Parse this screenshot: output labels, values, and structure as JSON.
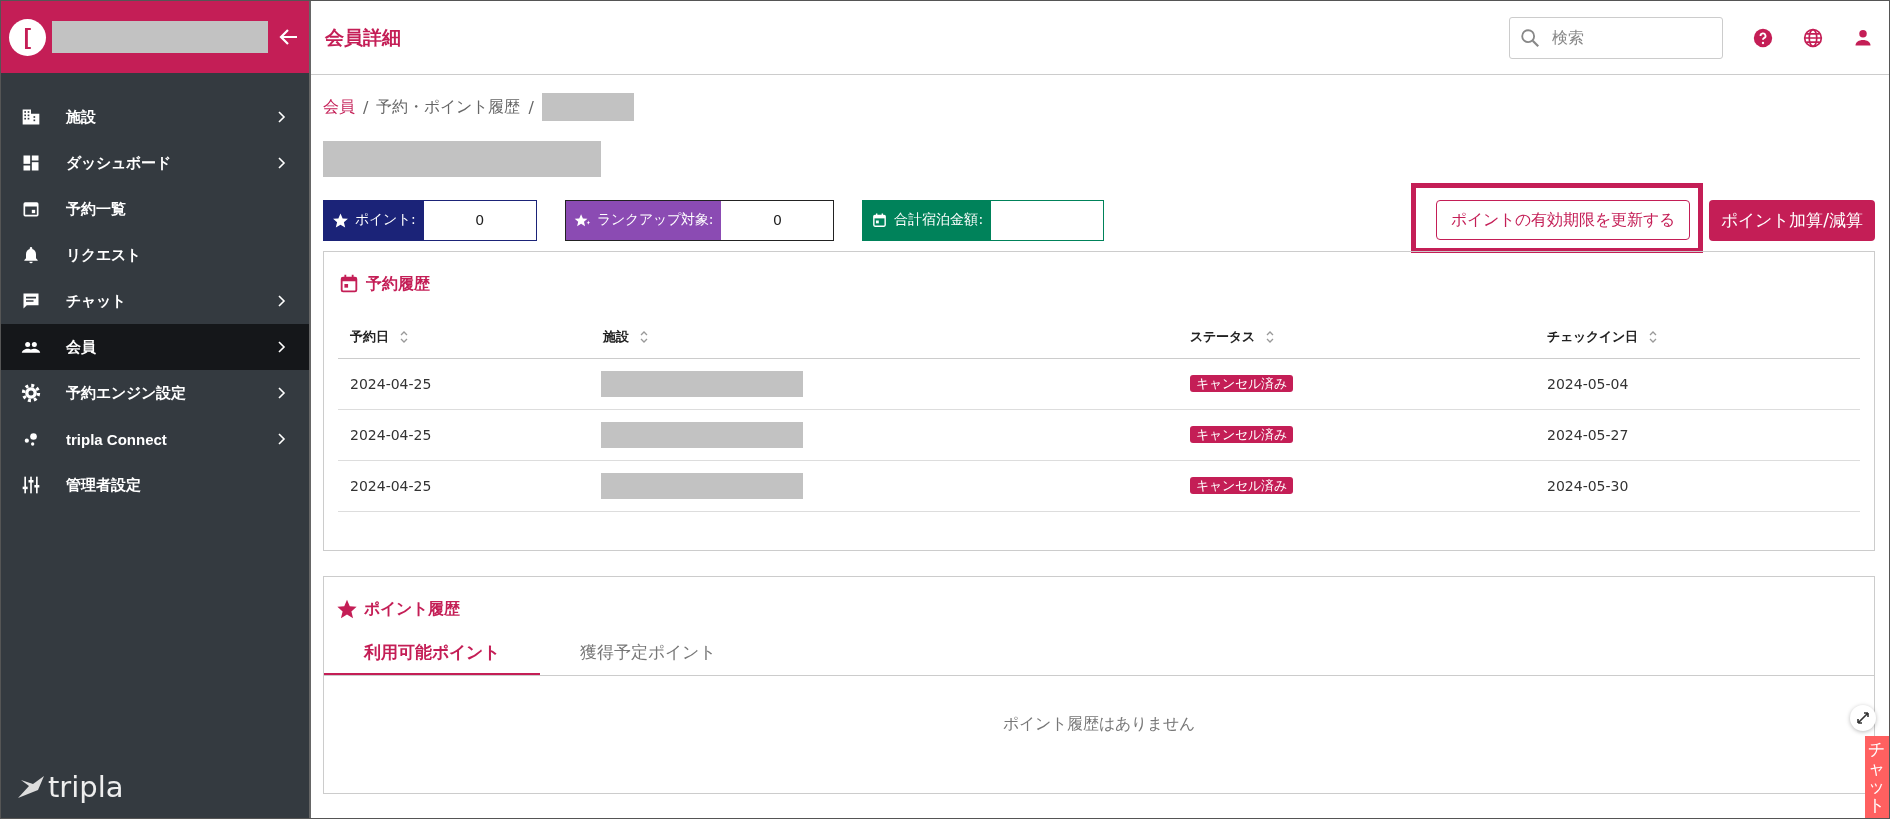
{
  "sidebar": {
    "logo_mark": "[",
    "items": [
      {
        "label": "施設",
        "kind": "building",
        "has_submenu": true,
        "selected": false
      },
      {
        "label": "ダッシュボード",
        "kind": "dashboard",
        "has_submenu": true,
        "selected": false
      },
      {
        "label": "予約一覧",
        "kind": "calendar",
        "has_submenu": false,
        "selected": false
      },
      {
        "label": "リクエスト",
        "kind": "bell",
        "has_submenu": false,
        "selected": false
      },
      {
        "label": "チャット",
        "kind": "chat",
        "has_submenu": true,
        "selected": false
      },
      {
        "label": "会員",
        "kind": "people",
        "has_submenu": true,
        "selected": true
      },
      {
        "label": "予約エンジン設定",
        "kind": "gear",
        "has_submenu": true,
        "selected": false
      },
      {
        "label": "tripla Connect",
        "kind": "dots",
        "has_submenu": true,
        "selected": false
      },
      {
        "label": "管理者設定",
        "kind": "sliders",
        "has_submenu": false,
        "selected": false
      }
    ],
    "brand": "tripla"
  },
  "header": {
    "title": "会員詳細",
    "search": {
      "placeholder": "検索"
    }
  },
  "breadcrumb": [
    {
      "label": "会員",
      "link": true,
      "separator": "/"
    },
    {
      "label": "予約・ポイント履歴",
      "link": false,
      "separator": "/"
    }
  ],
  "stats": [
    {
      "label": "ポイント:",
      "value": "0",
      "kind": "star",
      "color": "#1b2378"
    },
    {
      "label": "ランクアップ対象:",
      "value": "0",
      "kind": "star-sparkle",
      "color": "#8b4bb3"
    },
    {
      "label": "合計宿泊金額:",
      "kind": "calendar",
      "color": "#00825a"
    }
  ],
  "actions": {
    "renew_button": "ポイントの有効期限を更新する",
    "adjust_button": "ポイント加算/減算"
  },
  "reservations": {
    "title": "予約履歴",
    "columns": [
      "予約日",
      "施設",
      "ステータス",
      "チェックイン日"
    ],
    "rows": [
      {
        "date": "2024-04-25",
        "status": "キャンセル済み",
        "checkin": "2024-05-04"
      },
      {
        "date": "2024-04-25",
        "status": "キャンセル済み",
        "checkin": "2024-05-27"
      },
      {
        "date": "2024-04-25",
        "status": "キャンセル済み",
        "checkin": "2024-05-30"
      }
    ]
  },
  "points": {
    "title": "ポイント履歴",
    "tabs": [
      {
        "label": "利用可能ポイント",
        "selected": true
      },
      {
        "label": "獲得予定ポイント",
        "selected": false
      }
    ],
    "empty_message": "ポイント履歴はありません"
  },
  "chat_tab": "チャット"
}
